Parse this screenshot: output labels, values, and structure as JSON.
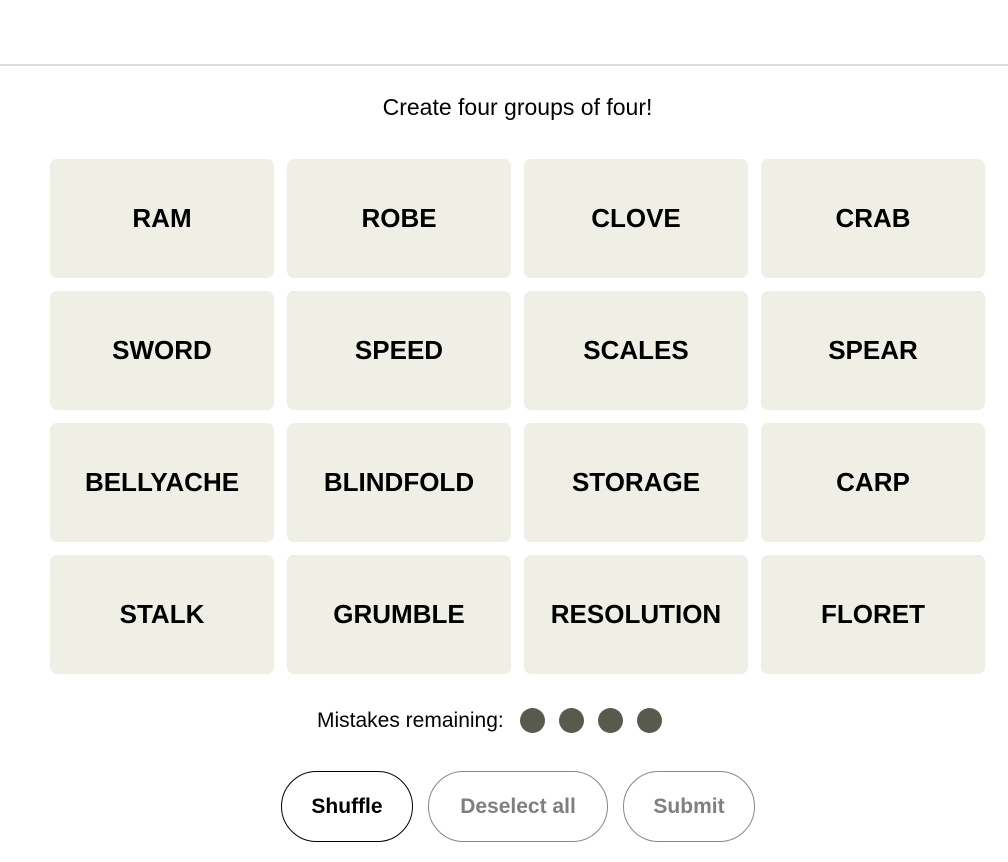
{
  "title": "Create four groups of four!",
  "tiles": [
    "RAM",
    "ROBE",
    "CLOVE",
    "CRAB",
    "SWORD",
    "SPEED",
    "SCALES",
    "SPEAR",
    "BELLYACHE",
    "BLINDFOLD",
    "STORAGE",
    "CARP",
    "STALK",
    "GRUMBLE",
    "RESOLUTION",
    "FLORET"
  ],
  "mistakes": {
    "label": "Mistakes remaining:",
    "remaining": 4,
    "dot_color": "#5a594e"
  },
  "buttons": {
    "shuffle": "Shuffle",
    "deselect": "Deselect all",
    "submit": "Submit"
  },
  "colors": {
    "tile_bg": "#efefe6"
  }
}
